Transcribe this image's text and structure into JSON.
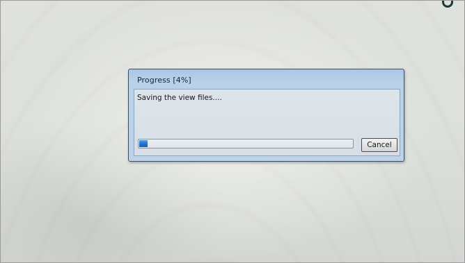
{
  "dialog": {
    "title": "Progress [4%]",
    "message": "Saving the view files....",
    "progress_fraction": 0.04,
    "cancel_label": "Cancel"
  },
  "colors": {
    "dialog_frame": "#bcd3ea",
    "progress_fill": "#1d6fd0"
  }
}
